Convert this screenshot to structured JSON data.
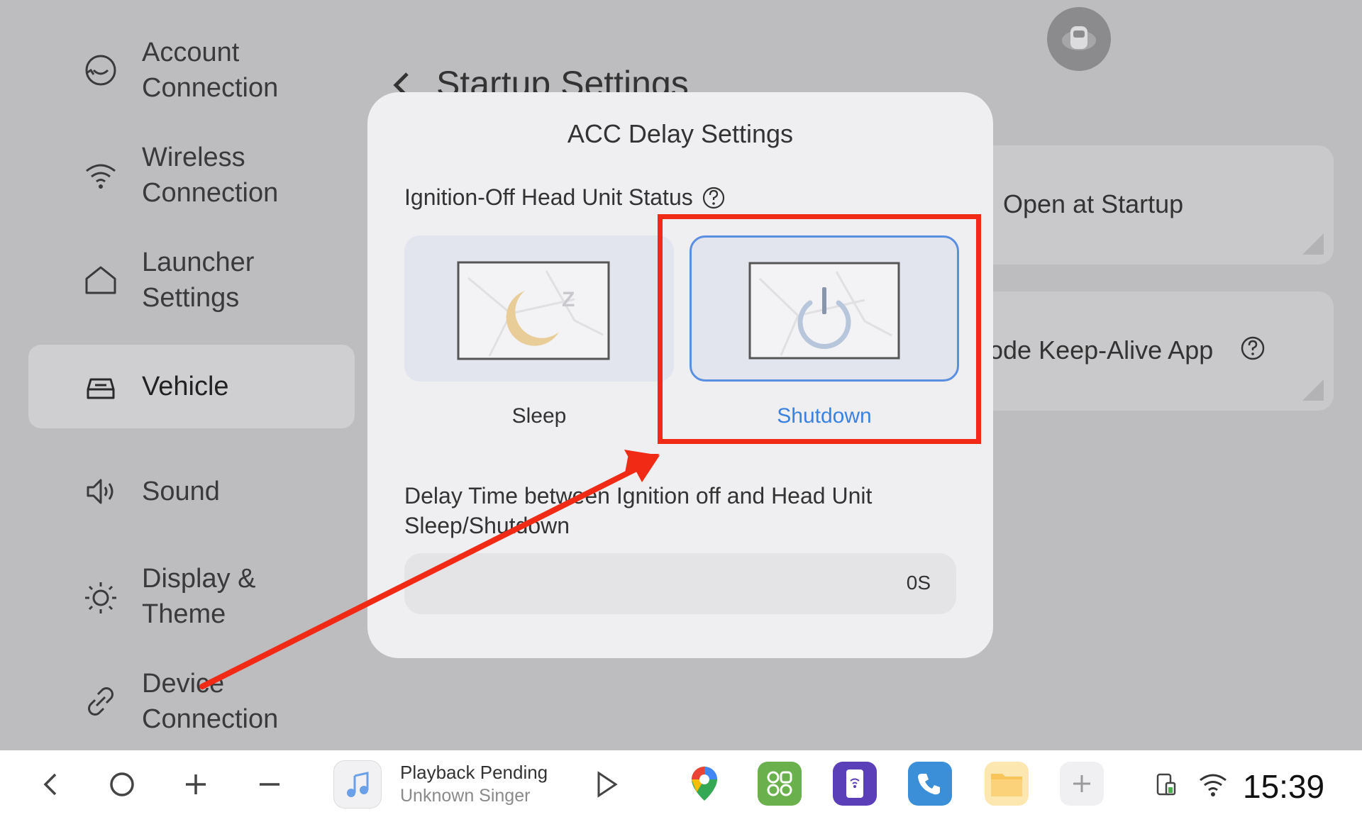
{
  "sidebar": {
    "items": [
      {
        "label": "Account\nConnection",
        "icon": "account-icon"
      },
      {
        "label": "Wireless\nConnection",
        "icon": "wifi-icon"
      },
      {
        "label": "Launcher\nSettings",
        "icon": "home-icon"
      },
      {
        "label": "Vehicle",
        "icon": "car-icon"
      },
      {
        "label": "Sound",
        "icon": "speaker-icon"
      },
      {
        "label": "Display &\nTheme",
        "icon": "sun-icon"
      },
      {
        "label": "Device\nConnection",
        "icon": "link-icon"
      }
    ]
  },
  "page": {
    "title": "Startup Settings",
    "card1_text": "Open at Startup",
    "card2_text": "ode Keep-Alive App"
  },
  "dialog": {
    "title": "ACC Delay Settings",
    "subtitle": "Ignition-Off Head Unit Status",
    "options": [
      {
        "label": "Sleep",
        "selected": false
      },
      {
        "label": "Shutdown",
        "selected": true
      }
    ],
    "delay_label": "Delay Time between Ignition off and Head Unit Sleep/Shutdown",
    "delay_value": "0S"
  },
  "taskbar": {
    "music_title": "Playback Pending",
    "music_artist": "Unknown Singer",
    "clock": "15:39"
  },
  "colors": {
    "accent": "#3a82e0",
    "annotation": "#f02a14"
  }
}
